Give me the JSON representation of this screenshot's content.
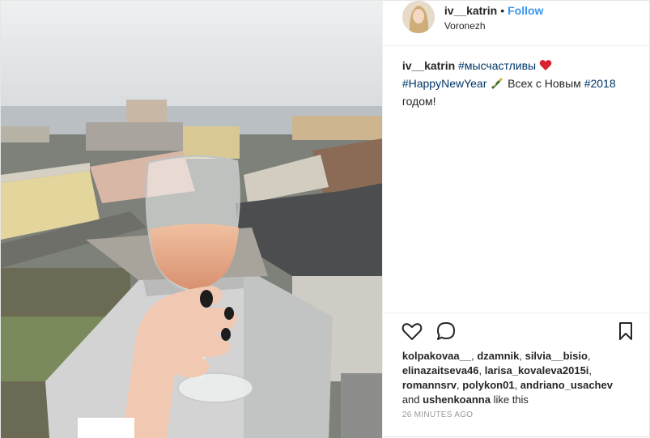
{
  "header": {
    "username": "iv__katrin",
    "separator": "•",
    "follow_label": "Follow",
    "location": "Voronezh"
  },
  "caption": {
    "username": "iv__katrin",
    "tag1": "#мысчастливы",
    "heart_icon": "red-heart-emoji",
    "tag2": "#HappyNewYear",
    "bottle_icon": "champagne-bottle-emoji",
    "text1": "Всех с Новым",
    "tag3": "#2018",
    "text2": "годом!"
  },
  "actions": {
    "like_icon": "heart-outline-icon",
    "comment_icon": "comment-bubble-icon",
    "save_icon": "bookmark-icon"
  },
  "likes": {
    "users": [
      "kolpakovaa__",
      "dzamnik",
      "silvia__bisio",
      "elinazaitseva46",
      "larisa_kovaleva2015i",
      "romannsrv",
      "polykon01",
      "andriano_usachev"
    ],
    "and": "and",
    "last_user": "ushenkoanna",
    "suffix": "like this"
  },
  "timestamp": "26 MINUTES AGO",
  "colors": {
    "follow": "#3897f0",
    "hashtag": "#003569",
    "timestamp": "#999999"
  }
}
